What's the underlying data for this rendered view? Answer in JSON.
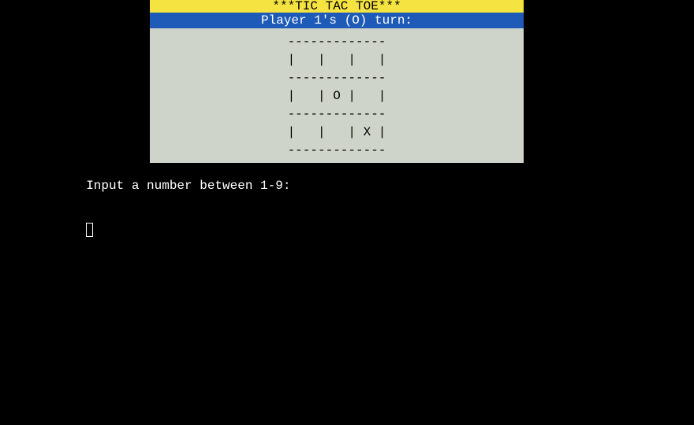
{
  "title": "***TIC TAC TOE***",
  "status": "Player 1's (O) turn:",
  "board": {
    "hr": "-------------",
    "row1": "|   |   |   |",
    "row2": "|   | O |   |",
    "row3": "|   |   | X |"
  },
  "prompt": "Input a number between 1-9:",
  "colors": {
    "title_bg": "#f5e342",
    "status_bg": "#1e5bb8",
    "board_bg": "#cfd4ca",
    "terminal_bg": "#000000"
  },
  "game_state": {
    "current_player": 1,
    "current_symbol": "O",
    "cells": [
      "",
      "",
      "",
      "",
      "O",
      "",
      "",
      "",
      "X"
    ]
  }
}
